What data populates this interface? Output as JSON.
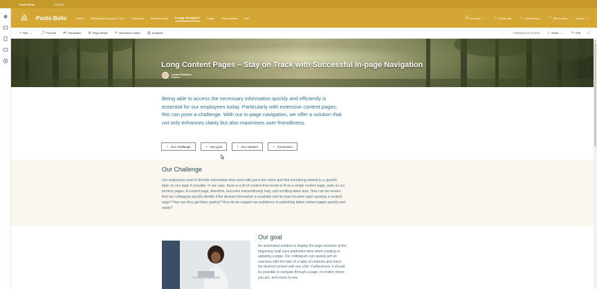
{
  "suitebar": {
    "site_name": "Punto Bello",
    "edit_link": "Edit link"
  },
  "header": {
    "title": "Punto Bello",
    "nav": [
      "Home",
      "Multilingual Document Card",
      "Document",
      "Mathew News",
      "In-page Navigation",
      "Pages",
      "Site contents",
      "Edit"
    ],
    "active_nav": "In-page Navigation",
    "actions": [
      {
        "icon": "star-icon",
        "label": "My tasks"
      },
      {
        "icon": "plus-icon",
        "label": "Create site"
      },
      {
        "icon": "star-icon",
        "label": "Not following"
      },
      {
        "icon": "share-icon",
        "label": "Site access"
      },
      {
        "icon": "chevron-down-icon",
        "label": "Groups"
      }
    ]
  },
  "commandbar": {
    "left": [
      {
        "icon": "plus-icon",
        "label": "New"
      },
      {
        "icon": "promote-icon",
        "label": "Promote"
      },
      {
        "icon": "translate-icon",
        "label": "Translation"
      },
      {
        "icon": "gear-icon",
        "label": "Page details"
      },
      {
        "icon": "reader-icon",
        "label": "Immersive reader"
      },
      {
        "icon": "analytics-icon",
        "label": "Analytics"
      }
    ],
    "published": "Published 29.10.2024",
    "share": "Share",
    "edit": "Edit"
  },
  "hero": {
    "title": "Long Content Pages – Stay on Track with Successful In-page Navigation",
    "author_name": "Lynna Robbins",
    "author_role": "Planner"
  },
  "intro": "Being able to access the necessary information quickly and efficiently is essential for our employees today. Particularly with extensive content pages, this can pose a challenge. With our in-page navigation, we offer a solution that not only enhances clarity but also maximises user-friendliness.",
  "anchors": [
    "Our Challenge",
    "Our goal",
    "Our solution",
    "Conclusion"
  ],
  "challenge": {
    "title": "Our Challenge",
    "text": "Our employees want to find the information they need with just a few clicks and find everything related to a specific topic on one page if possible. In our case, there is a lot of content that needs to fit on a single content page, such as our product pages. A content page, therefore, becomes extraordinarily long, and scrolling takes time. How can we ensure that our colleagues quickly identify if the desired information is available and its exact location upon opening a content page? How can they get there quickly? How do we support our publishers in publishing latest content pages quickly and easily?"
  },
  "goal": {
    "title": "Our goal",
    "text": "An automated solution to display the page structure at the beginning shall save publishers time when creating or updating a page. Our colleagues can quickly get an overview with the help of a table of contents and reach the desired content with one click. Furthermore, it should be possible to navigate through a page, no matter where you are, and return to any"
  },
  "colors": {
    "brand": "#d4a734",
    "suitebar": "#c59a2b",
    "heading": "#2c4a5a",
    "intro": "#2f6f8f"
  }
}
